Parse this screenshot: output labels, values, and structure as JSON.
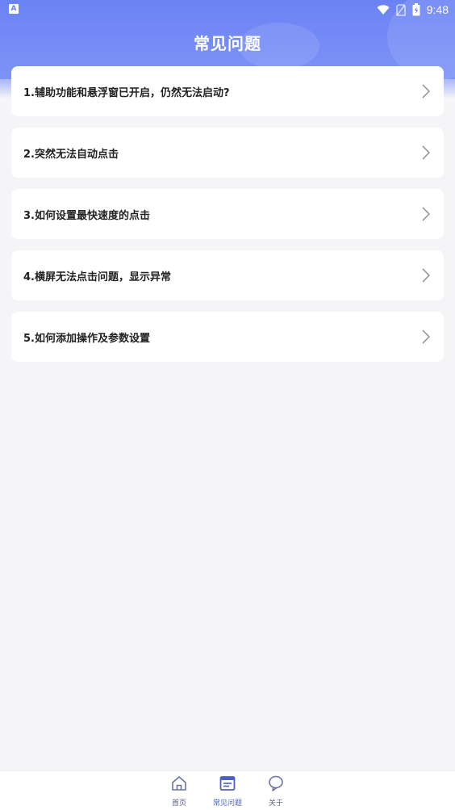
{
  "status_bar": {
    "left_icon": "A",
    "time": "9:48"
  },
  "header": {
    "title": "常见问题"
  },
  "faq": {
    "items": [
      {
        "label": "1.辅助功能和悬浮窗已开启，仍然无法启动?"
      },
      {
        "label": "2.突然无法自动点击"
      },
      {
        "label": "3.如何设置最快速度的点击"
      },
      {
        "label": "4.横屏无法点击问题，显示异常"
      },
      {
        "label": "5.如何添加操作及参数设置"
      }
    ]
  },
  "bottom_nav": {
    "items": [
      {
        "label": "首页",
        "icon": "home-icon"
      },
      {
        "label": "常见问题",
        "icon": "faq-icon",
        "active": true
      },
      {
        "label": "关于",
        "icon": "about-icon"
      }
    ]
  },
  "colors": {
    "header": "#6b82f4",
    "background": "#f5f5f7",
    "nav_active": "#4d5fc4"
  }
}
